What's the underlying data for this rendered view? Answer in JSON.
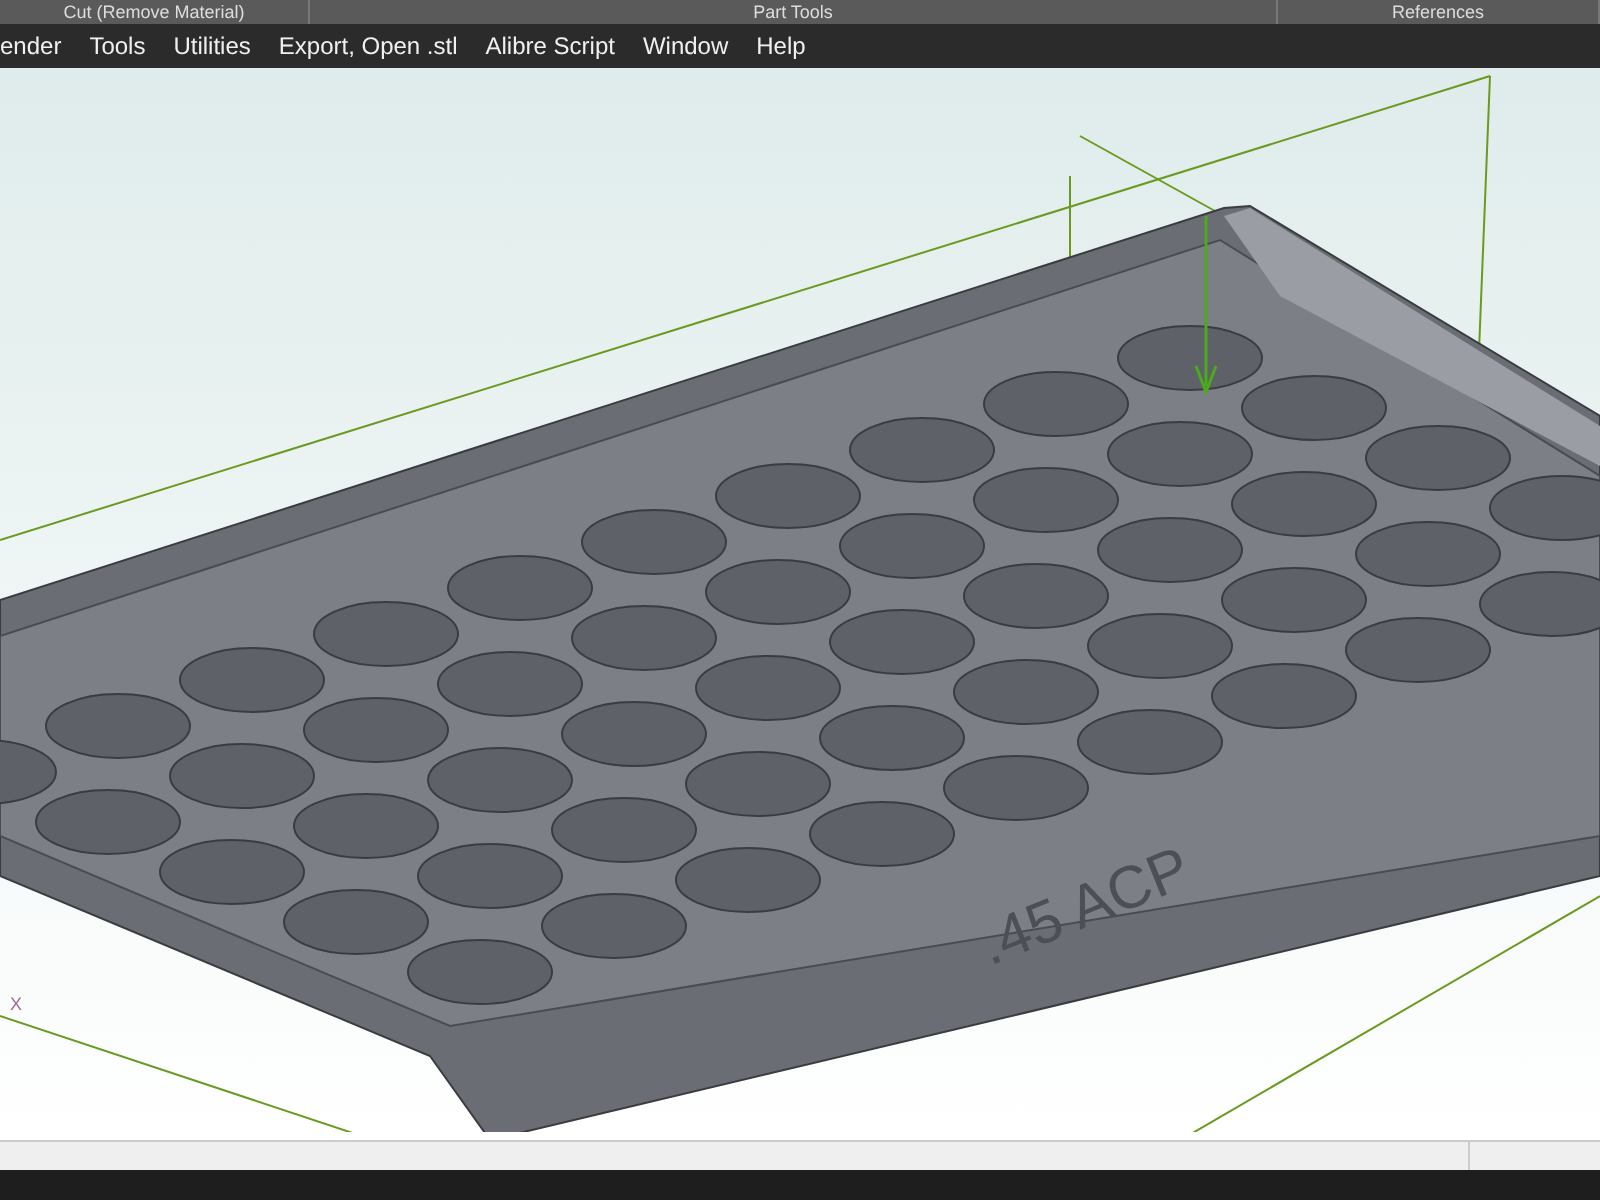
{
  "ribbon_groups": [
    "Cut (Remove Material)",
    "Part Tools",
    "References"
  ],
  "menu": [
    "ender",
    "Tools",
    "Utilities",
    "Export, Open .stl",
    "Alibre Script",
    "Window",
    "Help"
  ],
  "viewport": {
    "engraving": ".45 ACP",
    "axis_label": "X"
  }
}
